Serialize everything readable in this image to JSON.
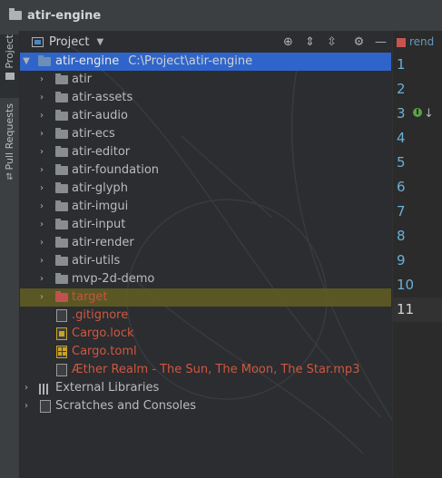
{
  "window": {
    "title": "atir-engine"
  },
  "sidebar": {
    "tabs": [
      {
        "label": "Project"
      },
      {
        "label": "Pull Requests"
      }
    ]
  },
  "toolbar": {
    "view_label": "Project",
    "icons": [
      "locate-icon",
      "expand-all-icon",
      "collapse-all-icon",
      "gear-icon",
      "minimize-icon"
    ]
  },
  "tree": {
    "root": {
      "name": "atir-engine",
      "path": "C:\\Project\\atir-engine"
    },
    "folders": [
      "atir",
      "atir-assets",
      "atir-audio",
      "atir-ecs",
      "atir-editor",
      "atir-foundation",
      "atir-glyph",
      "atir-imgui",
      "atir-input",
      "atir-render",
      "atir-utils",
      "mvp-2d-demo"
    ],
    "excluded_folder": "target",
    "files": [
      ".gitignore",
      "Cargo.lock",
      "Cargo.toml",
      "Æther Realm - The Sun, The Moon, The Star.mp3"
    ],
    "external_libraries": "External Libraries",
    "scratches": "Scratches and Consoles"
  },
  "editor": {
    "tab_label": "rend",
    "line_numbers": [
      "1",
      "2",
      "3",
      "4",
      "5",
      "6",
      "7",
      "8",
      "9",
      "10",
      "11"
    ],
    "current_line": "11"
  },
  "colors": {
    "accent_selection": "#2f65ca",
    "excluded_highlight": "#5e5a24",
    "untracked_text": "#d0573f",
    "line_number": "#6ab0d8"
  }
}
